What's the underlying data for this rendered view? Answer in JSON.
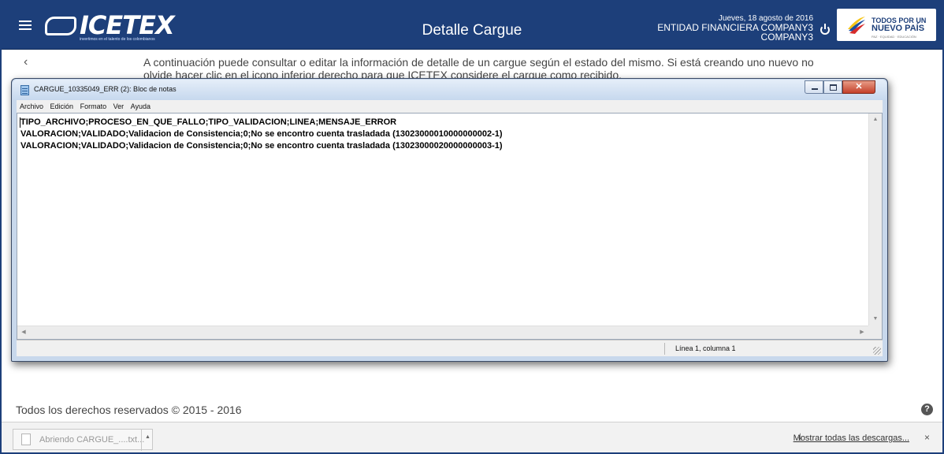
{
  "header": {
    "page_title": "Detalle Cargue",
    "logo_text": "ICETEX",
    "logo_tagline": "invertimos en el talento de los colombianos",
    "date": "Jueves, 18 agosto de 2016",
    "entity": "ENTIDAD FINANCIERA COMPANY3",
    "company": "COMPANY3",
    "gov_logo": {
      "line1": "TODOS POR UN",
      "line2": "NUEVO PAÍS",
      "line3": "PAZ · EQUIDAD · EDUCACIÓN"
    },
    "bar_color": "#1d3f7a"
  },
  "intro_text": "A continuación puede consultar o editar la información de detalle de un cargue según el estado del mismo. Si está creando uno nuevo no olvide hacer clic en el icono inferior derecho para que ICETEX considere el cargue como recibido.",
  "notepad": {
    "title": "CARGUE_10335049_ERR (2): Bloc de notas",
    "menu": [
      "Archivo",
      "Edición",
      "Formato",
      "Ver",
      "Ayuda"
    ],
    "lines": [
      "TIPO_ARCHIVO;PROCESO_EN_QUE_FALLO;TIPO_VALIDACION;LINEA;MENSAJE_ERROR",
      "VALORACION;VALIDADO;Validacion de Consistencia;0;No se encontro cuenta trasladada (13023000010000000002-1)",
      "VALORACION;VALIDADO;Validacion de Consistencia;0;No se encontro cuenta trasladada (13023000020000000003-1)"
    ],
    "status": "Línea 1, columna 1"
  },
  "footer": {
    "copyright": "Todos los derechos reservados © 2015 - 2016",
    "help": "?"
  },
  "download_bar": {
    "item_name": "Abriendo CARGUE_....txt...",
    "show_all": "Mostrar todas las descargas...",
    "close": "×"
  }
}
